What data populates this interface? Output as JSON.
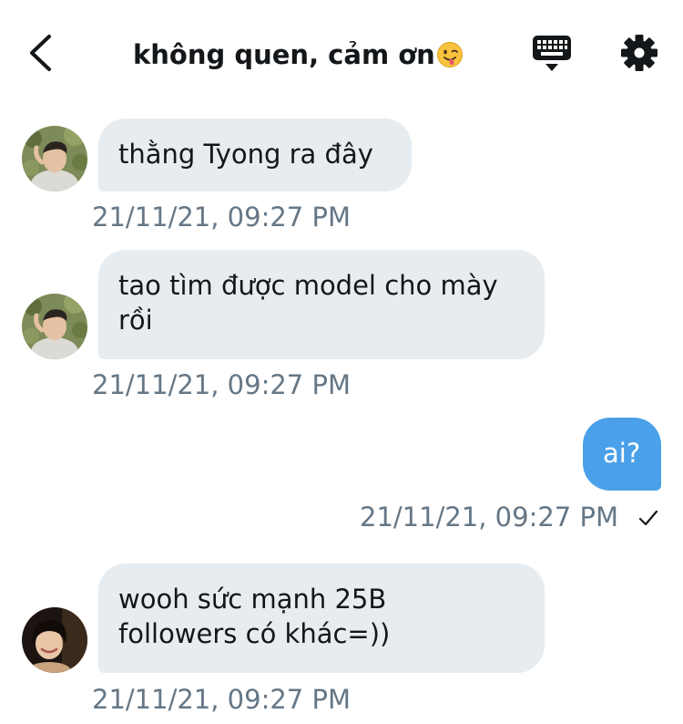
{
  "header": {
    "title": "không quen, cảm ơn",
    "title_emoji": "face-with-tongue-emoji",
    "back_icon": "chevron-left-icon",
    "keyboard_icon": "keyboard-icon",
    "settings_icon": "gear-icon"
  },
  "messages": [
    {
      "direction": "incoming",
      "text": "thằng Tyong ra đây",
      "timestamp": "21/11/21, 09:27 PM"
    },
    {
      "direction": "incoming",
      "lines": [
        "tao tìm được model cho mày",
        "rồi"
      ],
      "timestamp": "21/11/21, 09:27 PM"
    },
    {
      "direction": "outgoing",
      "text": "ai?",
      "timestamp": "21/11/21, 09:27 PM",
      "status_icon": "checkmark-icon"
    },
    {
      "direction": "incoming",
      "lines": [
        "wooh sức mạnh 25B",
        "followers có khác=))"
      ],
      "timestamp": "21/11/21, 09:27 PM"
    }
  ],
  "colors": {
    "incoming_bubble": "#e6ecf0",
    "outgoing_bubble": "#4aa0e9",
    "timestamp": "#657786",
    "text": "#14171a"
  }
}
